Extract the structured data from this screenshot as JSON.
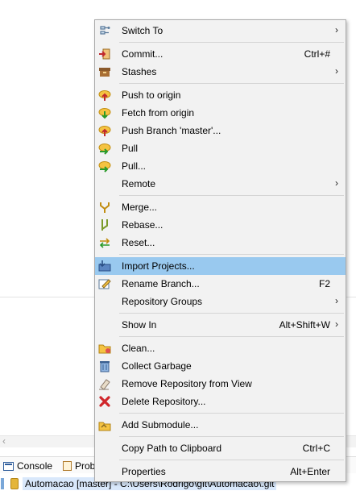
{
  "menu": {
    "items": [
      {
        "label": "Switch To",
        "shortcut": "",
        "submenu": true,
        "icon": "switch-branch-icon"
      },
      {
        "label": "Commit...",
        "shortcut": "Ctrl+#",
        "submenu": false,
        "icon": "commit-icon"
      },
      {
        "label": "Stashes",
        "shortcut": "",
        "submenu": true,
        "icon": "stash-icon"
      },
      {
        "label": "Push to origin",
        "shortcut": "",
        "submenu": false,
        "icon": "push-icon"
      },
      {
        "label": "Fetch from origin",
        "shortcut": "",
        "submenu": false,
        "icon": "fetch-icon"
      },
      {
        "label": "Push Branch 'master'...",
        "shortcut": "",
        "submenu": false,
        "icon": "push-branch-icon"
      },
      {
        "label": "Pull",
        "shortcut": "",
        "submenu": false,
        "icon": "pull-icon"
      },
      {
        "label": "Pull...",
        "shortcut": "",
        "submenu": false,
        "icon": "pull-dialog-icon"
      },
      {
        "label": "Remote",
        "shortcut": "",
        "submenu": true,
        "icon": ""
      },
      {
        "label": "Merge...",
        "shortcut": "",
        "submenu": false,
        "icon": "merge-icon"
      },
      {
        "label": "Rebase...",
        "shortcut": "",
        "submenu": false,
        "icon": "rebase-icon"
      },
      {
        "label": "Reset...",
        "shortcut": "",
        "submenu": false,
        "icon": "reset-icon"
      },
      {
        "label": "Import Projects...",
        "shortcut": "",
        "submenu": false,
        "icon": "import-projects-icon",
        "highlighted": true
      },
      {
        "label": "Rename Branch...",
        "shortcut": "F2",
        "submenu": false,
        "icon": "rename-icon"
      },
      {
        "label": "Repository Groups",
        "shortcut": "",
        "submenu": true,
        "icon": ""
      },
      {
        "label": "Show In",
        "shortcut": "Alt+Shift+W",
        "submenu": true,
        "icon": ""
      },
      {
        "label": "Clean...",
        "shortcut": "",
        "submenu": false,
        "icon": "clean-icon"
      },
      {
        "label": "Collect Garbage",
        "shortcut": "",
        "submenu": false,
        "icon": "trash-icon"
      },
      {
        "label": "Remove Repository from View",
        "shortcut": "",
        "submenu": false,
        "icon": "eraser-icon"
      },
      {
        "label": "Delete Repository...",
        "shortcut": "",
        "submenu": false,
        "icon": "delete-icon"
      },
      {
        "label": "Add Submodule...",
        "shortcut": "",
        "submenu": false,
        "icon": "add-submodule-icon"
      },
      {
        "label": "Copy Path to Clipboard",
        "shortcut": "Ctrl+C",
        "submenu": false,
        "icon": ""
      },
      {
        "label": "Properties",
        "shortcut": "Alt+Enter",
        "submenu": false,
        "icon": ""
      }
    ]
  },
  "background": {
    "tabs": [
      {
        "label": "Console",
        "icon": "console-icon"
      },
      {
        "label": "Prob",
        "icon": "problems-icon"
      }
    ],
    "repo_row": "Automacao [master] - C:\\Users\\Rodrigo\\git\\Automacao\\.git"
  },
  "colors": {
    "menu_bg": "#f2f2f2",
    "highlight": "#99c9ef",
    "separator": "#d5d5d5"
  }
}
